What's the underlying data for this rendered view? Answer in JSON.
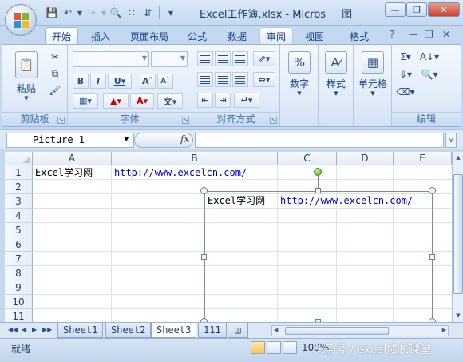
{
  "window": {
    "title": "Excel工作簿.xlsx - Micros",
    "title_suffix": "图"
  },
  "ribbon": {
    "tabs": [
      "开始",
      "插入",
      "页面布局",
      "公式",
      "数据",
      "审阅",
      "视图",
      "格式"
    ],
    "active_tab": "开始",
    "help_icon": "?",
    "groups": {
      "clipboard": {
        "label": "剪贴板",
        "paste": "粘贴"
      },
      "font": {
        "label": "字体",
        "font_name": "",
        "font_size": ""
      },
      "alignment": {
        "label": "对齐方式"
      },
      "number": {
        "label": "数字"
      },
      "styles": {
        "label": "样式"
      },
      "cells": {
        "label": "单元格"
      },
      "editing": {
        "label": "编辑"
      }
    }
  },
  "formula_bar": {
    "name_box": "Picture 1",
    "fx": "fx",
    "content": ""
  },
  "grid": {
    "columns": [
      "A",
      "B",
      "C",
      "D",
      "E"
    ],
    "rows": [
      "1",
      "2",
      "3",
      "4",
      "5",
      "6",
      "7",
      "8",
      "9",
      "10",
      "11"
    ],
    "cells": {
      "A1": "Excel学习网",
      "B1": "http://www.excelcn.com/"
    }
  },
  "picture": {
    "name": "Picture 1",
    "text": "Excel学习网",
    "link": "http://www.excelcn.com/"
  },
  "sheets": {
    "tabs": [
      "Sheet1",
      "Sheet2",
      "Sheet3",
      "111"
    ],
    "active": "Sheet3"
  },
  "status": {
    "ready": "就绪",
    "zoom": "100%"
  },
  "watermark": "头条号 / excel成长课堂",
  "colors": {
    "accent": "#15428b",
    "ribbon_bg": "#dbe7f5",
    "link": "#0000d0",
    "rotate_handle": "#4cae24"
  }
}
